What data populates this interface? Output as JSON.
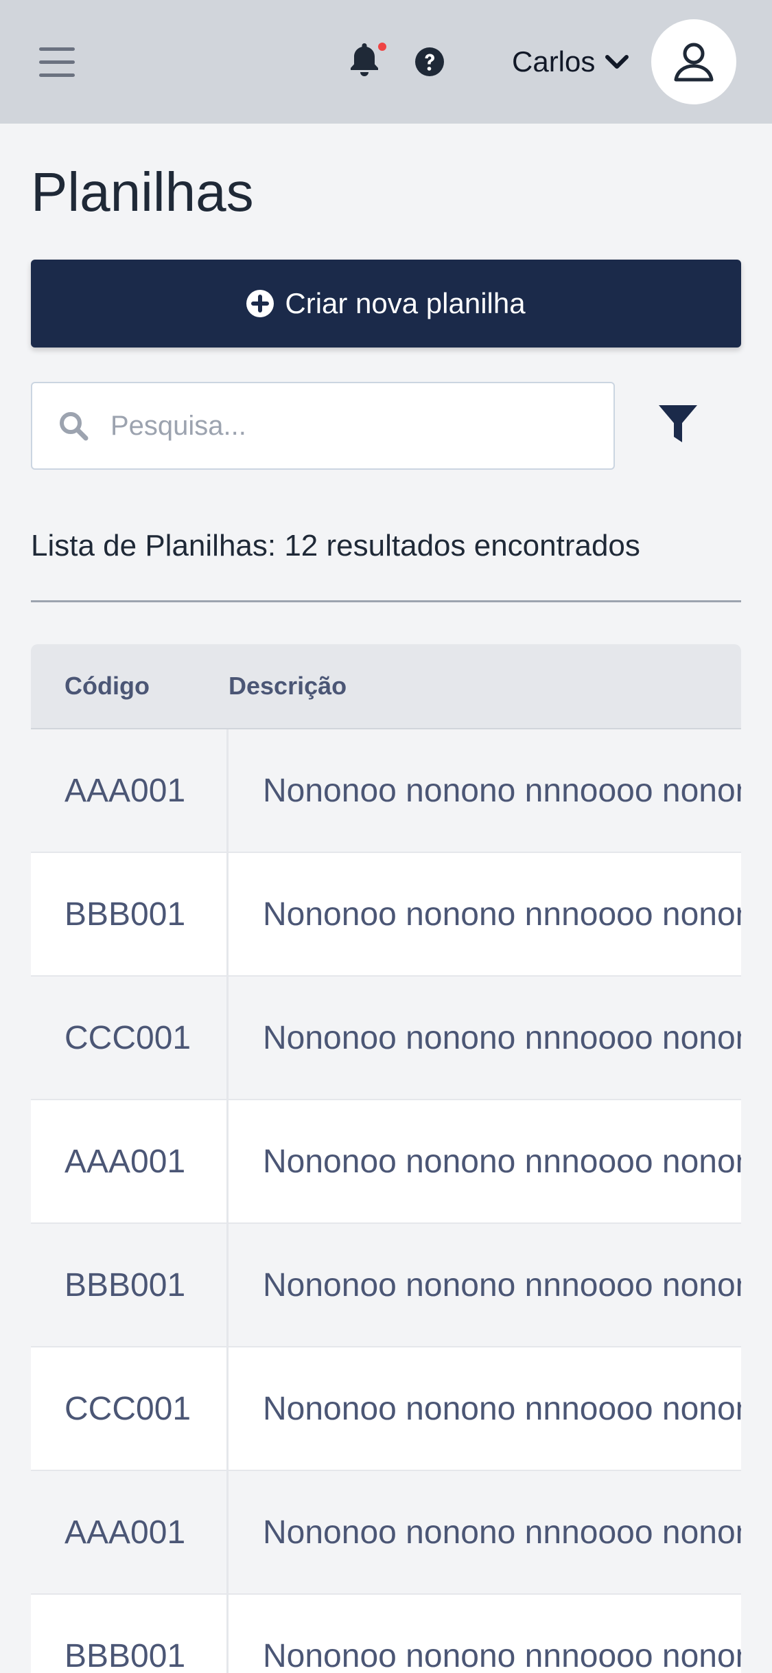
{
  "header": {
    "user_name": "Carlos",
    "icons": [
      "menu-icon",
      "bell-icon",
      "help-icon",
      "chevron-down-icon",
      "user-icon"
    ],
    "notification_dot_color": "#ef4444"
  },
  "page": {
    "title": "Planilhas",
    "create_button_label": "Criar nova planilha",
    "search_placeholder": "Pesquisa...",
    "results_text": "Lista de Planilhas: 12 resultados encontrados"
  },
  "table": {
    "columns": {
      "code": "Código",
      "description": "Descrição"
    },
    "rows": [
      {
        "code": "AAA001",
        "description": "Nononoo nonono nnnoooo nonon"
      },
      {
        "code": "BBB001",
        "description": "Nononoo nonono nnnoooo nonon"
      },
      {
        "code": "CCC001",
        "description": "Nononoo nonono nnnoooo nonon"
      },
      {
        "code": "AAA001",
        "description": "Nononoo nonono nnnoooo nonon"
      },
      {
        "code": "BBB001",
        "description": "Nononoo nonono nnnoooo nonon"
      },
      {
        "code": "CCC001",
        "description": "Nononoo nonono nnnoooo nonon"
      },
      {
        "code": "AAA001",
        "description": "Nononoo nonono nnnoooo nonon"
      },
      {
        "code": "BBB001",
        "description": "Nononoo nonono nnnoooo nonon"
      }
    ]
  },
  "colors": {
    "primary_button": "#1b2a4a",
    "topbar": "#d1d5db",
    "background": "#f3f4f6"
  }
}
